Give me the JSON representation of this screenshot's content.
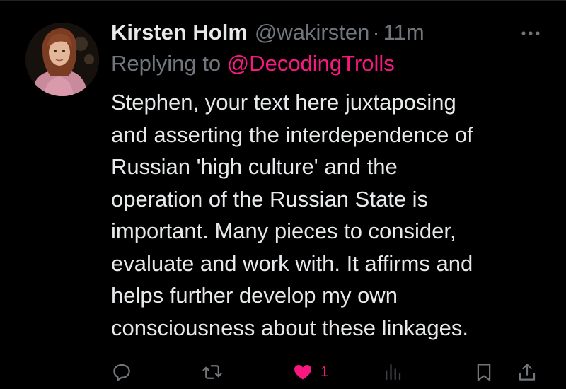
{
  "tweet": {
    "display_name": "Kirsten Holm",
    "handle": "@wakirsten",
    "separator": "·",
    "time": "11m",
    "replying_prefix": "Replying to",
    "replying_to": "@DecodingTrolls",
    "body_lines": [
      "Stephen, your text here juxtaposing",
      "and asserting the interdependence of",
      "Russian 'high culture' and the",
      "operation of the Russian State is",
      "important. Many pieces to consider,",
      "evaluate and work with. It affirms and",
      "helps further develop my own",
      "consciousness about these linkages."
    ]
  },
  "actions": {
    "reply_icon": "reply-icon",
    "retweet_icon": "retweet-icon",
    "like_icon": "heart-filled-icon",
    "like_count": "1",
    "views_icon": "views-icon",
    "bookmark_icon": "bookmark-icon",
    "share_icon": "share-icon"
  },
  "colors": {
    "background": "#000000",
    "text": "#e7e9ea",
    "secondary": "#71767b",
    "accent": "#f91880"
  }
}
